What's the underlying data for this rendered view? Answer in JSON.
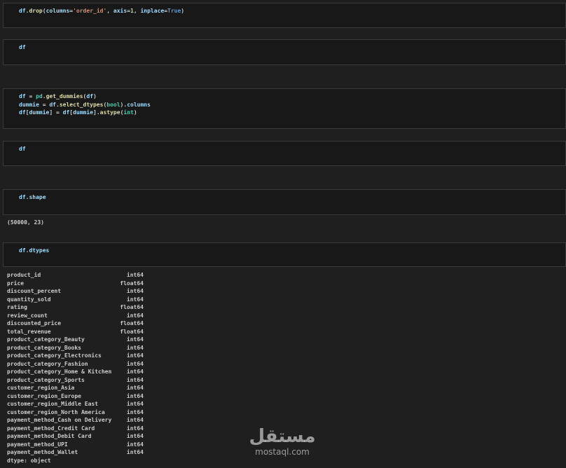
{
  "cells": [
    {
      "id": "drop",
      "tokens": [
        [
          {
            "t": "df",
            "c": "v"
          },
          {
            "t": ".",
            "c": "p"
          },
          {
            "t": "drop",
            "c": "f"
          },
          {
            "t": "(",
            "c": "p"
          },
          {
            "t": "columns",
            "c": "v"
          },
          {
            "t": "=",
            "c": "p"
          },
          {
            "t": "'order_id'",
            "c": "s"
          },
          {
            "t": ", ",
            "c": "p"
          },
          {
            "t": "axis",
            "c": "v"
          },
          {
            "t": "=",
            "c": "p"
          },
          {
            "t": "1",
            "c": "n"
          },
          {
            "t": ", ",
            "c": "p"
          },
          {
            "t": "inplace",
            "c": "v"
          },
          {
            "t": "=",
            "c": "p"
          },
          {
            "t": "True",
            "c": "k"
          },
          {
            "t": ")",
            "c": "p"
          }
        ]
      ]
    },
    {
      "id": "df1",
      "tokens": [
        [
          {
            "t": "df",
            "c": "v"
          }
        ]
      ]
    },
    {
      "id": "dummies",
      "tokens": [
        [
          {
            "t": "df",
            "c": "v"
          },
          {
            "t": " = ",
            "c": "p"
          },
          {
            "t": "pd",
            "c": "t"
          },
          {
            "t": ".",
            "c": "p"
          },
          {
            "t": "get_dummies",
            "c": "f"
          },
          {
            "t": "(",
            "c": "p"
          },
          {
            "t": "df",
            "c": "v"
          },
          {
            "t": ")",
            "c": "p"
          }
        ],
        [
          {
            "t": "dummie",
            "c": "v"
          },
          {
            "t": " = ",
            "c": "p"
          },
          {
            "t": "df",
            "c": "v"
          },
          {
            "t": ".",
            "c": "p"
          },
          {
            "t": "select_dtypes",
            "c": "f"
          },
          {
            "t": "(",
            "c": "p"
          },
          {
            "t": "bool",
            "c": "t"
          },
          {
            "t": ").",
            "c": "p"
          },
          {
            "t": "columns",
            "c": "v"
          }
        ],
        [
          {
            "t": "df",
            "c": "v"
          },
          {
            "t": "[",
            "c": "p"
          },
          {
            "t": "dummie",
            "c": "v"
          },
          {
            "t": "] = ",
            "c": "p"
          },
          {
            "t": "df",
            "c": "v"
          },
          {
            "t": "[",
            "c": "p"
          },
          {
            "t": "dummie",
            "c": "v"
          },
          {
            "t": "].",
            "c": "p"
          },
          {
            "t": "astype",
            "c": "f"
          },
          {
            "t": "(",
            "c": "p"
          },
          {
            "t": "int",
            "c": "t"
          },
          {
            "t": ")",
            "c": "p"
          }
        ]
      ]
    },
    {
      "id": "df2",
      "tokens": [
        [
          {
            "t": "df",
            "c": "v"
          }
        ]
      ]
    },
    {
      "id": "shape",
      "tokens": [
        [
          {
            "t": "df",
            "c": "v"
          },
          {
            "t": ".",
            "c": "p"
          },
          {
            "t": "shape",
            "c": "v"
          }
        ]
      ]
    },
    {
      "id": "dtypes",
      "tokens": [
        [
          {
            "t": "df",
            "c": "v"
          },
          {
            "t": ".",
            "c": "p"
          },
          {
            "t": "dtypes",
            "c": "v"
          }
        ]
      ]
    }
  ],
  "shape_output": "(50000, 23)",
  "dtypes": [
    {
      "name": "product_id",
      "type": "int64"
    },
    {
      "name": "price",
      "type": "float64"
    },
    {
      "name": "discount_percent",
      "type": "int64"
    },
    {
      "name": "quantity_sold",
      "type": "int64"
    },
    {
      "name": "rating",
      "type": "float64"
    },
    {
      "name": "review_count",
      "type": "int64"
    },
    {
      "name": "discounted_price",
      "type": "float64"
    },
    {
      "name": "total_revenue",
      "type": "float64"
    },
    {
      "name": "product_category_Beauty",
      "type": "int64"
    },
    {
      "name": "product_category_Books",
      "type": "int64"
    },
    {
      "name": "product_category_Electronics",
      "type": "int64"
    },
    {
      "name": "product_category_Fashion",
      "type": "int64"
    },
    {
      "name": "product_category_Home & Kitchen",
      "type": "int64"
    },
    {
      "name": "product_category_Sports",
      "type": "int64"
    },
    {
      "name": "customer_region_Asia",
      "type": "int64"
    },
    {
      "name": "customer_region_Europe",
      "type": "int64"
    },
    {
      "name": "customer_region_Middle East",
      "type": "int64"
    },
    {
      "name": "customer_region_North America",
      "type": "int64"
    },
    {
      "name": "payment_method_Cash on Delivery",
      "type": "int64"
    },
    {
      "name": "payment_method_Credit Card",
      "type": "int64"
    },
    {
      "name": "payment_method_Debit Card",
      "type": "int64"
    },
    {
      "name": "payment_method_UPI",
      "type": "int64"
    },
    {
      "name": "payment_method_Wallet",
      "type": "int64"
    }
  ],
  "dtype_footer": "dtype: object",
  "watermark": {
    "arabic": "مستقل",
    "latin": "mostaql.com"
  }
}
